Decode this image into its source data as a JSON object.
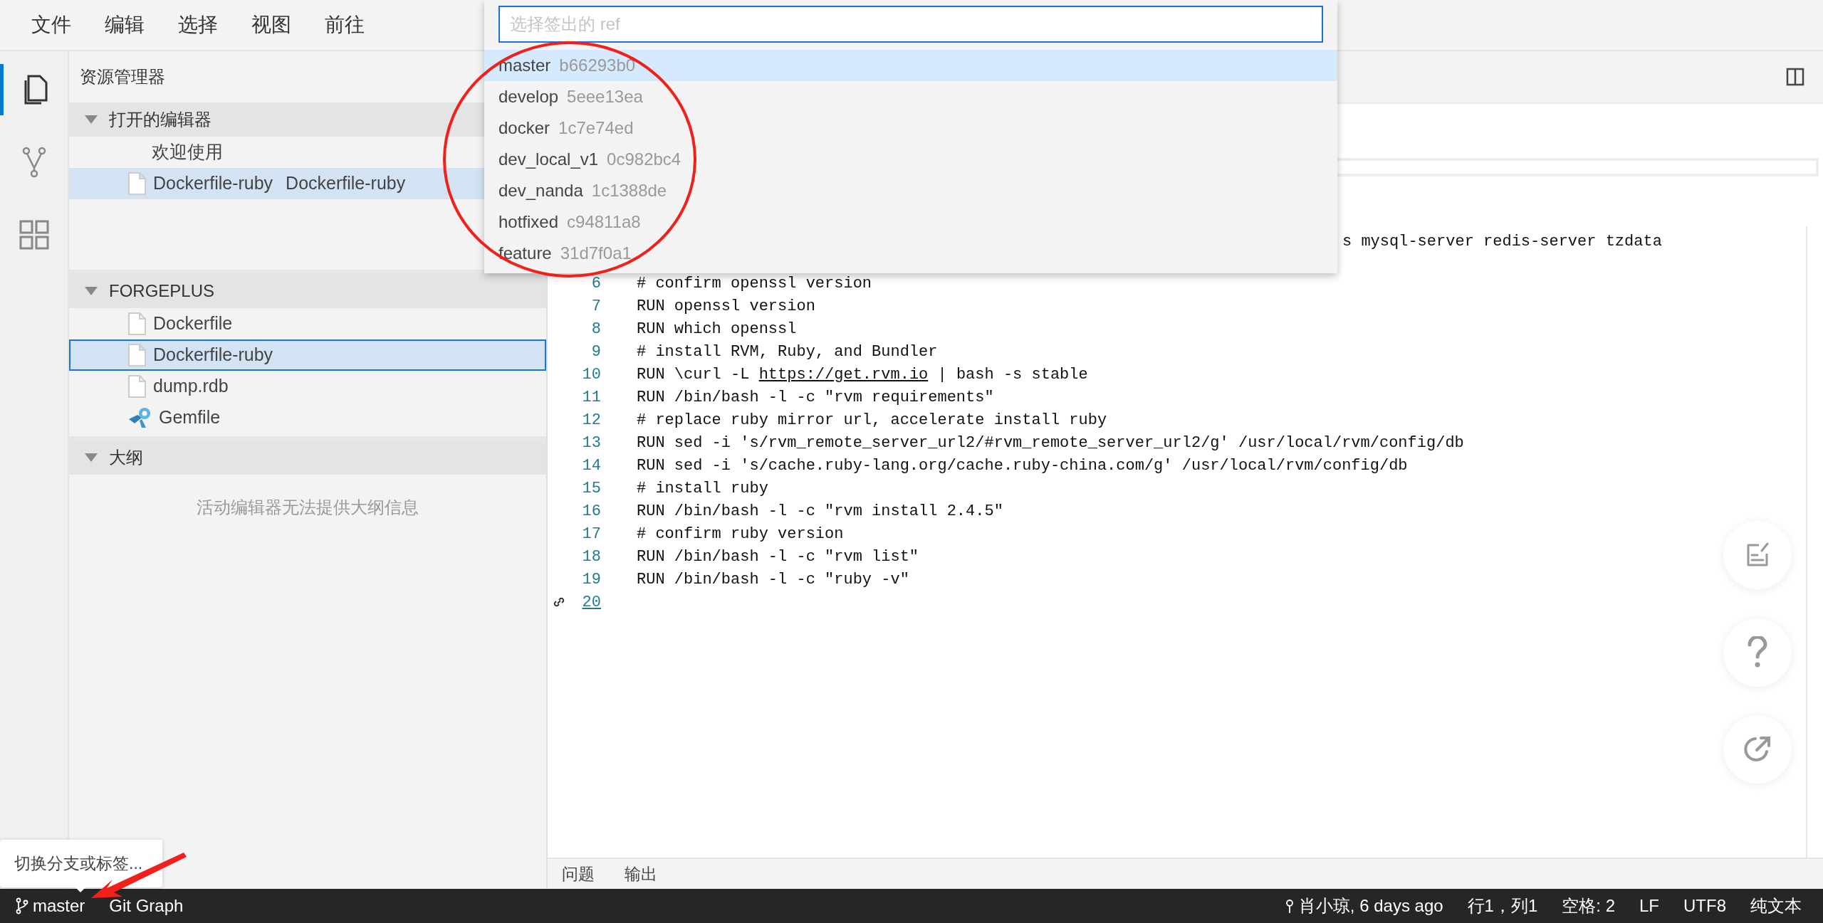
{
  "menu": [
    "文件",
    "编辑",
    "选择",
    "视图",
    "前往"
  ],
  "activity_bar": [
    {
      "kind": "files",
      "selected": true
    },
    {
      "kind": "source-control",
      "selected": false
    },
    {
      "kind": "extensions",
      "selected": false
    }
  ],
  "sidebar": {
    "title": "资源管理器",
    "sections": [
      {
        "title": "打开的编辑器",
        "expanded": true,
        "items": [
          {
            "label": "欢迎使用",
            "kind": "plain",
            "selected": false
          },
          {
            "label": "Dockerfile-ruby",
            "description": "Dockerfile-ruby",
            "kind": "file",
            "selected": true
          }
        ]
      },
      {
        "title": "FORGEPLUS",
        "expanded": true,
        "items": [
          {
            "label": "Dockerfile",
            "kind": "file",
            "selected": false
          },
          {
            "label": "Dockerfile-ruby",
            "kind": "file",
            "selected": true
          },
          {
            "label": "dump.rdb",
            "kind": "file",
            "selected": false
          },
          {
            "label": "Gemfile",
            "kind": "gem",
            "selected": false
          }
        ]
      },
      {
        "title": "大纲",
        "expanded": true,
        "message": "活动编辑器无法提供大纲信息"
      }
    ]
  },
  "quick_pick": {
    "placeholder": "选择签出的 ref",
    "items": [
      {
        "name": "master",
        "hash": "b66293b0",
        "selected": true
      },
      {
        "name": "develop",
        "hash": "5eee13ea",
        "selected": false
      },
      {
        "name": "docker",
        "hash": "1c7e74ed",
        "selected": false
      },
      {
        "name": "dev_local_v1",
        "hash": "0c982bc4",
        "selected": false
      },
      {
        "name": "dev_nanda",
        "hash": "1c1388de",
        "selected": false
      },
      {
        "name": "hotfixed",
        "hash": "c94811a8",
        "selected": false
      },
      {
        "name": "feature",
        "hash": "31d7f0a1",
        "selected": false
      }
    ]
  },
  "editor": {
    "lines": [
      {
        "text": "s mysql-server redis-server tzdata",
        "covered": true
      },
      {
        "number": "6",
        "text": "# confirm openssl version"
      },
      {
        "number": "7",
        "text": "RUN openssl version"
      },
      {
        "number": "8",
        "text": "RUN which openssl"
      },
      {
        "number": "9",
        "text": "# install RVM, Ruby, and Bundler"
      },
      {
        "number": "10",
        "segments": [
          {
            "text": "RUN \\curl -L "
          },
          {
            "text": "https://get.rvm.io",
            "link": true
          },
          {
            "text": " | bash -s stable"
          }
        ]
      },
      {
        "number": "11",
        "text": "RUN /bin/bash -l -c \"rvm requirements\""
      },
      {
        "number": "12",
        "text": "# replace ruby mirror url, accelerate install ruby"
      },
      {
        "number": "13",
        "text": "RUN sed -i 's/rvm_remote_server_url2/#rvm_remote_server_url2/g' /usr/local/rvm/config/db"
      },
      {
        "number": "14",
        "text": "RUN sed -i 's/cache.ruby-lang.org/cache.ruby-china.com/g' /usr/local/rvm/config/db"
      },
      {
        "number": "15",
        "text": "# install ruby"
      },
      {
        "number": "16",
        "text": "RUN /bin/bash -l -c \"rvm install 2.4.5\""
      },
      {
        "number": "17",
        "text": "# confirm ruby version"
      },
      {
        "number": "18",
        "text": "RUN /bin/bash -l -c \"rvm list\""
      },
      {
        "number": "19",
        "text": "RUN /bin/bash -l -c \"ruby -v\""
      },
      {
        "number": "20",
        "linked": true
      }
    ]
  },
  "floating_buttons": [
    {
      "kind": "edit"
    },
    {
      "kind": "help"
    },
    {
      "kind": "share"
    }
  ],
  "panel_tabs": [
    "问题",
    "输出"
  ],
  "tooltip": "切换分支或标签...",
  "status_bar": {
    "left": [
      {
        "kind": "branch",
        "label": "master"
      },
      {
        "kind": "text",
        "label": "Git Graph"
      }
    ],
    "right": [
      {
        "kind": "commit",
        "label": "肖小琼, 6 days ago"
      },
      {
        "kind": "text",
        "label": "行1，列1"
      },
      {
        "kind": "text",
        "label": "空格: 2"
      },
      {
        "kind": "text",
        "label": "LF"
      },
      {
        "kind": "text",
        "label": "UTF8"
      },
      {
        "kind": "text",
        "label": "纯文本"
      }
    ]
  },
  "annotations": [
    {
      "kind": "circle"
    },
    {
      "kind": "arrow"
    }
  ]
}
